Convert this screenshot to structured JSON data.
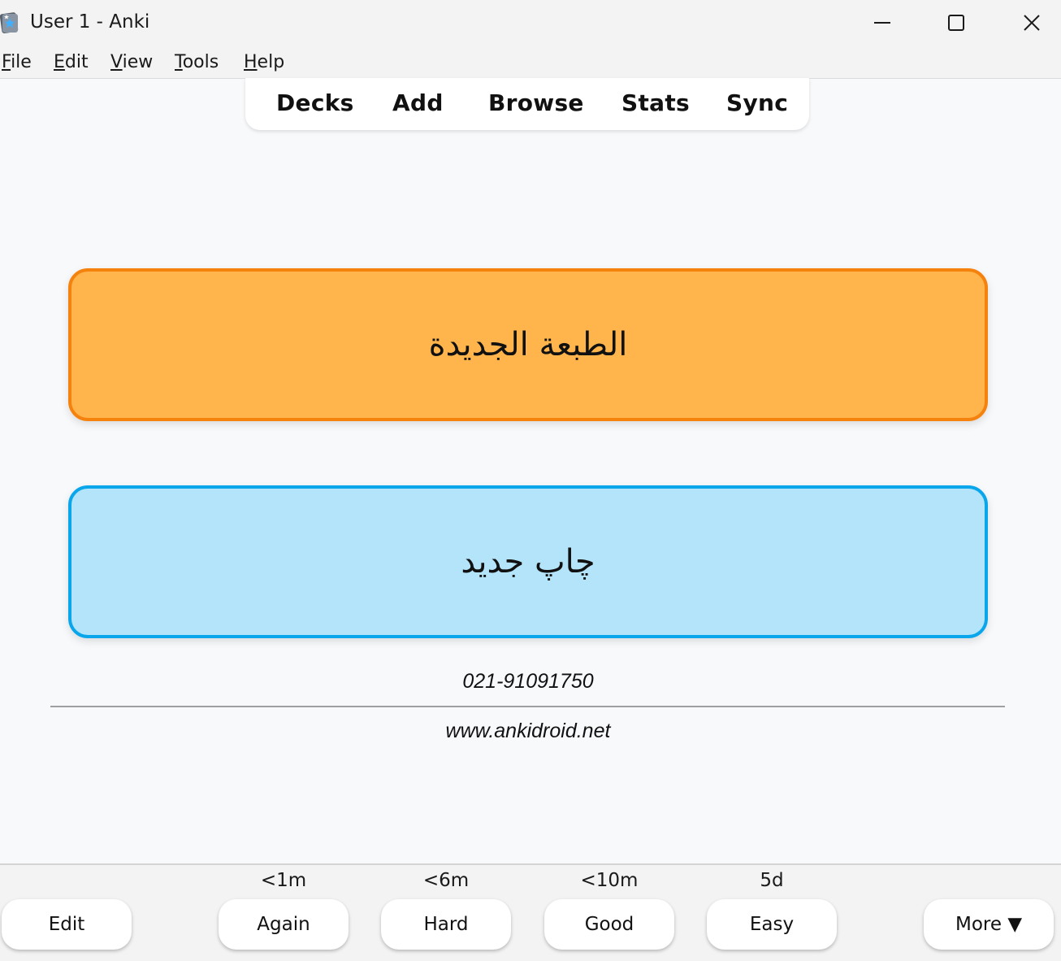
{
  "window": {
    "title": "User 1 - Anki",
    "controls": [
      "minimize-icon",
      "maximize-icon",
      "close-icon"
    ]
  },
  "menubar": {
    "items": [
      {
        "label": "File",
        "mnemonic": "F"
      },
      {
        "label": "Edit",
        "mnemonic": "E"
      },
      {
        "label": "View",
        "mnemonic": "V"
      },
      {
        "label": "Tools",
        "mnemonic": "T"
      },
      {
        "label": "Help",
        "mnemonic": "H"
      }
    ]
  },
  "toolbar": {
    "links": [
      "Decks",
      "Add",
      "Browse",
      "Stats",
      "Sync"
    ]
  },
  "card": {
    "front": "الطبعة الجديدة",
    "back": "چاپ جدید",
    "phone": "021-91091750",
    "website": "www.ankidroid.net",
    "front_color": "#ffb54c",
    "front_border": "#f5820d",
    "back_color": "#b3e4f9",
    "back_border": "#0aa6ec"
  },
  "answer_bar": {
    "edit_label": "Edit",
    "more_label": "More ▼",
    "buttons": [
      {
        "label": "Again",
        "interval": "<1m"
      },
      {
        "label": "Hard",
        "interval": "<6m"
      },
      {
        "label": "Good",
        "interval": "<10m"
      },
      {
        "label": "Easy",
        "interval": "5d"
      }
    ]
  }
}
